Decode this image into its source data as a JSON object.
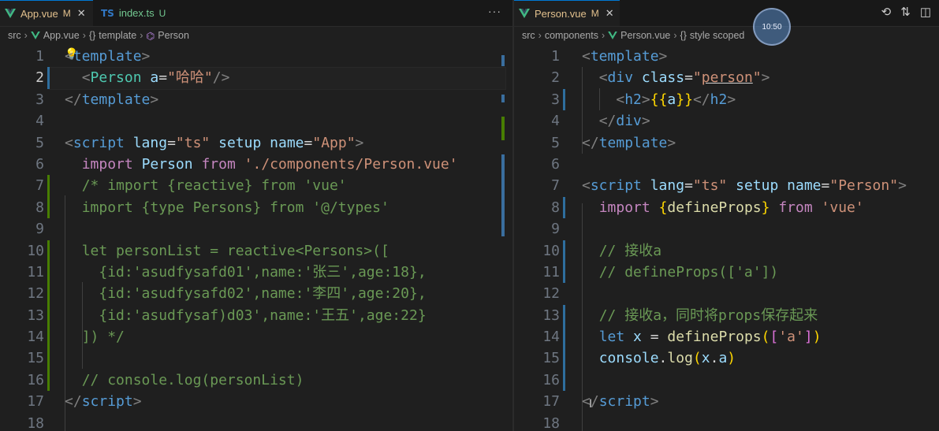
{
  "left": {
    "tabs": [
      {
        "label": "App.vue",
        "status": "M",
        "icon": "vue-icon"
      },
      {
        "label": "index.ts",
        "status": "U",
        "icon": "ts-icon"
      }
    ],
    "breadcrumb": [
      "src",
      "App.vue",
      "template",
      "Person"
    ],
    "lines": [
      "1",
      "2",
      "3",
      "4",
      "5",
      "6",
      "7",
      "8",
      "9",
      "10",
      "11",
      "12",
      "13",
      "14",
      "15",
      "16",
      "17",
      "18"
    ]
  },
  "right": {
    "tabs": [
      {
        "label": "Person.vue",
        "status": "M",
        "icon": "vue-icon"
      }
    ],
    "breadcrumb": [
      "src",
      "components",
      "Person.vue",
      "style scoped"
    ],
    "lines": [
      "1",
      "2",
      "3",
      "4",
      "5",
      "6",
      "7",
      "8",
      "9",
      "10",
      "11",
      "12",
      "13",
      "14",
      "15",
      "16",
      "17",
      "18"
    ]
  },
  "overlay": {
    "clock_text": "10:50"
  },
  "colors": {
    "accent": "#0078d4",
    "vue": "#41b883",
    "modified": "#e2c08d",
    "untracked": "#73c991"
  }
}
